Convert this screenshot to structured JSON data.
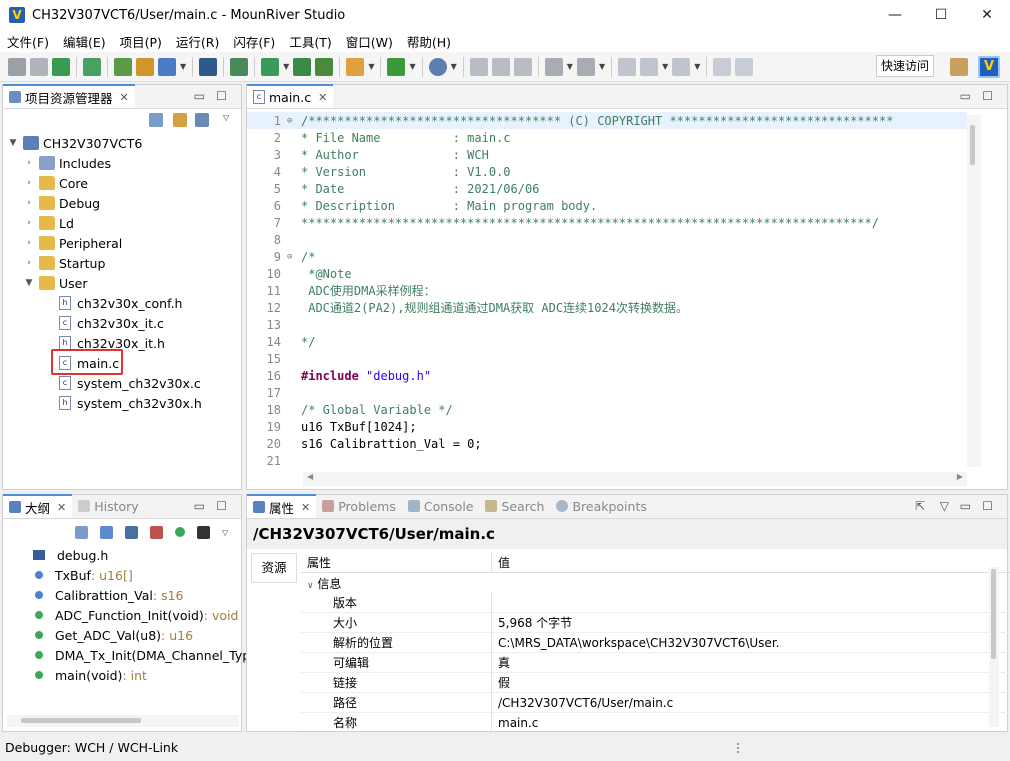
{
  "window": {
    "title": "CH32V307VCT6/User/main.c - MounRiver Studio",
    "minimize": "—",
    "maximize": "☐",
    "close": "✕"
  },
  "menu": [
    "文件(F)",
    "编辑(E)",
    "项目(P)",
    "运行(R)",
    "闪存(F)",
    "工具(T)",
    "窗口(W)",
    "帮助(H)"
  ],
  "toolbar": {
    "quick_access": "快速访问"
  },
  "explorer": {
    "tab": "项目资源管理器",
    "project": "CH32V307VCT6",
    "items": [
      {
        "label": "Includes",
        "kind": "includes"
      },
      {
        "label": "Core",
        "kind": "folder"
      },
      {
        "label": "Debug",
        "kind": "folder"
      },
      {
        "label": "Ld",
        "kind": "folder"
      },
      {
        "label": "Peripheral",
        "kind": "folder"
      },
      {
        "label": "Startup",
        "kind": "folder"
      },
      {
        "label": "User",
        "kind": "folder-open"
      }
    ],
    "user_files": [
      {
        "label": "ch32v30x_conf.h",
        "kind": "h"
      },
      {
        "label": "ch32v30x_it.c",
        "kind": "c"
      },
      {
        "label": "ch32v30x_it.h",
        "kind": "h"
      },
      {
        "label": "main.c",
        "kind": "c",
        "selected": true
      },
      {
        "label": "system_ch32v30x.c",
        "kind": "c"
      },
      {
        "label": "system_ch32v30x.h",
        "kind": "h"
      }
    ]
  },
  "editor": {
    "tab": "main.c",
    "lines": [
      {
        "n": "1",
        "t": "/*********************************** (C) COPYRIGHT *******************************",
        "c": "cmt",
        "fold": true
      },
      {
        "n": "2",
        "t": "* File Name          : main.c",
        "c": "cmt"
      },
      {
        "n": "3",
        "t": "* Author             : WCH",
        "c": "cmt"
      },
      {
        "n": "4",
        "t": "* Version            : V1.0.0",
        "c": "cmt"
      },
      {
        "n": "5",
        "t": "* Date               : 2021/06/06",
        "c": "cmt"
      },
      {
        "n": "6",
        "t": "* Description        : Main program body.",
        "c": "cmt"
      },
      {
        "n": "7",
        "t": "*******************************************************************************/",
        "c": "cmt"
      },
      {
        "n": "8",
        "t": "",
        "c": ""
      },
      {
        "n": "9",
        "t": "/*",
        "c": "cmt",
        "fold": true
      },
      {
        "n": "10",
        "t": " *@Note",
        "c": "cmt"
      },
      {
        "n": "11",
        "t": " ADC使用DMA采样例程：",
        "c": "cmt"
      },
      {
        "n": "12",
        "t": " ADC通道2(PA2),规则组通道通过DMA获取 ADC连续1024次转换数据。",
        "c": "cmt"
      },
      {
        "n": "13",
        "t": "",
        "c": ""
      },
      {
        "n": "14",
        "t": "*/",
        "c": "cmt"
      },
      {
        "n": "15",
        "t": "",
        "c": ""
      },
      {
        "n": "16",
        "t": "",
        "c": "inc"
      },
      {
        "n": "17",
        "t": "",
        "c": ""
      },
      {
        "n": "18",
        "t": "/* Global Variable */",
        "c": "cmt"
      },
      {
        "n": "19",
        "t": "u16 TxBuf[1024];",
        "c": ""
      },
      {
        "n": "20",
        "t": "s16 Calibrattion_Val = 0;",
        "c": ""
      },
      {
        "n": "21",
        "t": "",
        "c": ""
      }
    ],
    "include_kw": "#include",
    "include_str": " \"debug.h\""
  },
  "outline": {
    "tab": "大纲",
    "tab2": "History",
    "items": [
      {
        "name": "debug.h",
        "type": "",
        "icon": "include"
      },
      {
        "name": "TxBuf",
        "type": " : u16[]",
        "icon": "b"
      },
      {
        "name": "Calibrattion_Val",
        "type": " : s16",
        "icon": "b"
      },
      {
        "name": "ADC_Function_Init(void)",
        "type": " : void",
        "icon": "g"
      },
      {
        "name": "Get_ADC_Val(u8)",
        "type": " : u16",
        "icon": "g"
      },
      {
        "name": "DMA_Tx_Init(DMA_Channel_TypeD",
        "type": "",
        "icon": "g"
      },
      {
        "name": "main(void)",
        "type": " : int",
        "icon": "g"
      }
    ]
  },
  "bottom": {
    "tabs": [
      "属性",
      "Problems",
      "Console",
      "Search",
      "Breakpoints"
    ],
    "path": "/CH32V307VCT6/User/main.c",
    "side_tab": "资源",
    "col_prop": "属性",
    "col_val": "值",
    "group": "信息",
    "rows": [
      {
        "k": "版本",
        "v": ""
      },
      {
        "k": "大小",
        "v": "5,968 个字节"
      },
      {
        "k": "解析的位置",
        "v": "C:\\MRS_DATA\\workspace\\CH32V307VCT6\\User..."
      },
      {
        "k": "可编辑",
        "v": "真"
      },
      {
        "k": "链接",
        "v": "假"
      },
      {
        "k": "路径",
        "v": "/CH32V307VCT6/User/main.c"
      },
      {
        "k": "名称",
        "v": "main.c"
      }
    ]
  },
  "status": {
    "text": "Debugger: WCH / WCH-Link"
  }
}
